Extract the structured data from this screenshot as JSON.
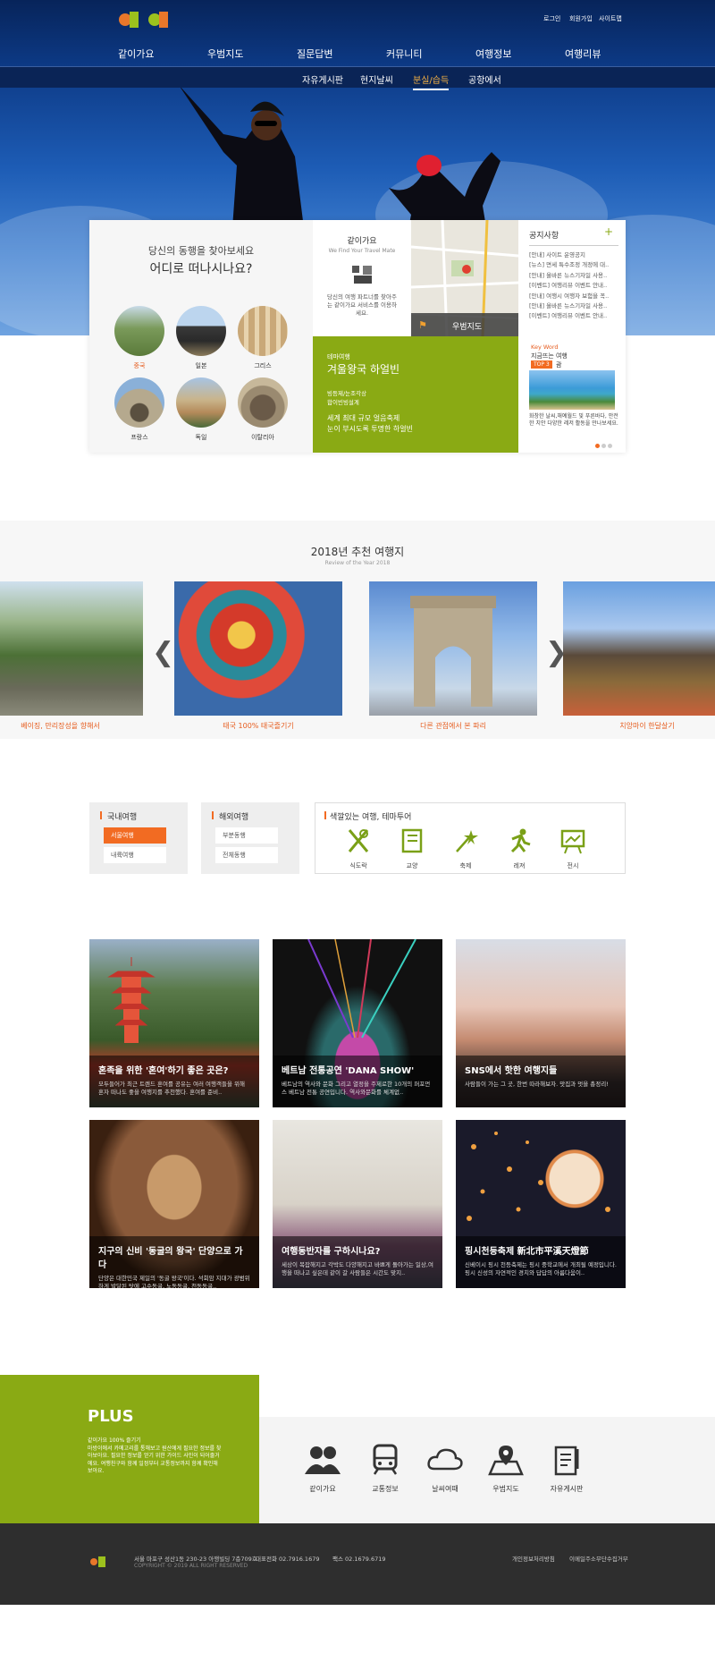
{
  "header": {
    "util_links": [
      "로그인",
      "회원가입",
      "사이트맵"
    ],
    "gnb": [
      "같이가요",
      "우범지도",
      "질문답변",
      "커뮤니티",
      "여행정보",
      "여행리뷰"
    ],
    "lnb": [
      "자유게시판",
      "현지날씨",
      "분실/습득",
      "공항에서"
    ],
    "lnb_active_index": 2
  },
  "search": {
    "subtitle": "당신의 동행을 찾아보세요",
    "title": "어디로 떠나시나요?",
    "countries": [
      "중국",
      "일본",
      "그리스",
      "프랑스",
      "독일",
      "이탈리아"
    ],
    "active_country": "중국"
  },
  "intro": {
    "title": "같이가요",
    "sub": "We Find Your Travel Mate",
    "desc": "당신의 여행 파트너를 찾아주는 같이가요 서비스를 이용하세요."
  },
  "map_tile": {
    "label": "우범지도"
  },
  "notice": {
    "title": "공지사항",
    "plus": "+",
    "items": [
      "[안내] 사이트 운영공지",
      "[뉴스] 면세 특수조정 개정에 대..",
      "[안내] 올바른 뉴스기자일 사용..",
      "[이벤트] 여행리뷰 이벤트 안내..",
      "[안내] 여행시 여행자 보험을 꼭..",
      "[안내] 올바른 뉴스기자일 사용..",
      "[이벤트] 여행리뷰 이벤트 안내.."
    ]
  },
  "theme_trip": {
    "label": "테마여행",
    "title": "겨울왕국 하얼빈",
    "tag1": "빙등제/눈조각상",
    "tag2": "합이빈빙설계",
    "desc1": "세계 최대 규모 얼음축제",
    "desc2": "눈이 부시도록 투명한 하얼빈"
  },
  "keyword": {
    "label": "Key Word",
    "title": "지금뜨는 여행",
    "badge": "TOP 3",
    "place": "괌",
    "desc": "화창한 날씨,해예월드 및 푸른바다, 안전한 치안 다양한 레저 활동을 만나보세요."
  },
  "recommend": {
    "title": "2018년 추천 여행지",
    "sub": "Review of the Year 2018",
    "prev": "❮",
    "next": "❯",
    "slides": [
      "베이징, 만리장성을 향해서",
      "태국 100% 태국즐기기",
      "다른 관점에서 본 파리",
      "치앙마이 한달살기"
    ]
  },
  "categories": {
    "domestic": {
      "title": "국내여행",
      "items": [
        "서울여행",
        "내륙여행"
      ]
    },
    "overseas": {
      "title": "해외여행",
      "items": [
        "부분동행",
        "전체동행"
      ]
    },
    "theme": {
      "title": "색깔있는 여행, 테마투어",
      "items": [
        "식도락",
        "교양",
        "축제",
        "레져",
        "전시"
      ]
    }
  },
  "cards": [
    {
      "title": "혼족을 위한 '혼여'하기 좋은 곳은?",
      "desc": "모두들어가 최근 트렌드 혼여를 공유는 여러 여행객들을 위해 혼자 떠나도 좋을 여행지를 추천했다. 혼여를 준비.."
    },
    {
      "title": "베트남 전통공연 'DANA SHOW'",
      "desc": "베트남의 역사와 문화 그리고 열정을 주제로한 10개의 퍼포먼스 베트남 전통 공연입니다. 역사와문화를 체계없.."
    },
    {
      "title": "SNS에서 핫한 여행지들",
      "desc": "사람들이 가는 그 곳, 한번 따라해보자. 맛집과 멋을 총정리!"
    },
    {
      "title": "지구의 신비 '동굴의 왕국' 단양으로 가다",
      "desc": "단양은 대한민국 제일의 '동굴 왕국'이다. 석회암 지대가 광범위하게 발달된 탓에 고수동굴, 노동동굴, 천동동굴.."
    },
    {
      "title": "여행동반자를 구하시나요?",
      "desc": "세상이 복잡해지고 각박도 다양해지고 바쁘게 돌아가는 일상,여행을 떠나고 싶은데 같이 갈 사람들은 시간도 맞지.."
    },
    {
      "title": "핑시천등축제 新北市平溪天燈節",
      "desc": "신베이시 핑시 천등축제는 핑시 중학교에서 개최될 예정입니다. 핑시 신성의 자연적인 경치와 답답의 아름다움이.."
    }
  ],
  "plus": {
    "title": "PLUS",
    "desc": "같이가요 100% 즐기기\n마방이에서 카메고리를 통해보고 원산에게 필요한 정보를 찾아보아요. 필요한 정보를 얻기 위한 가이드 사인이 되어줄거에요. 여행친구와 함께 일정부터 교통정보까지 함께 확인해보아요.",
    "items": [
      "같이가요",
      "교통정보",
      "날씨여때",
      "우범지도",
      "자유게시판"
    ]
  },
  "footer": {
    "address": "서울 마포구 성산1동 230-23 아행빌딩 7층709호",
    "tel": "대표전화 02.7916.1679",
    "fax": "팩스 02.1679.6719",
    "copyright": "COPYRIGHT © 2019 ALL RIGHT RESERVED",
    "links": [
      "개인정보처리방침",
      "이메일주소무단수집거부"
    ]
  },
  "colors": {
    "navy": "#0a2456",
    "orange": "#f26b22",
    "green": "#8aaa14",
    "footer": "#2e2e2e"
  }
}
